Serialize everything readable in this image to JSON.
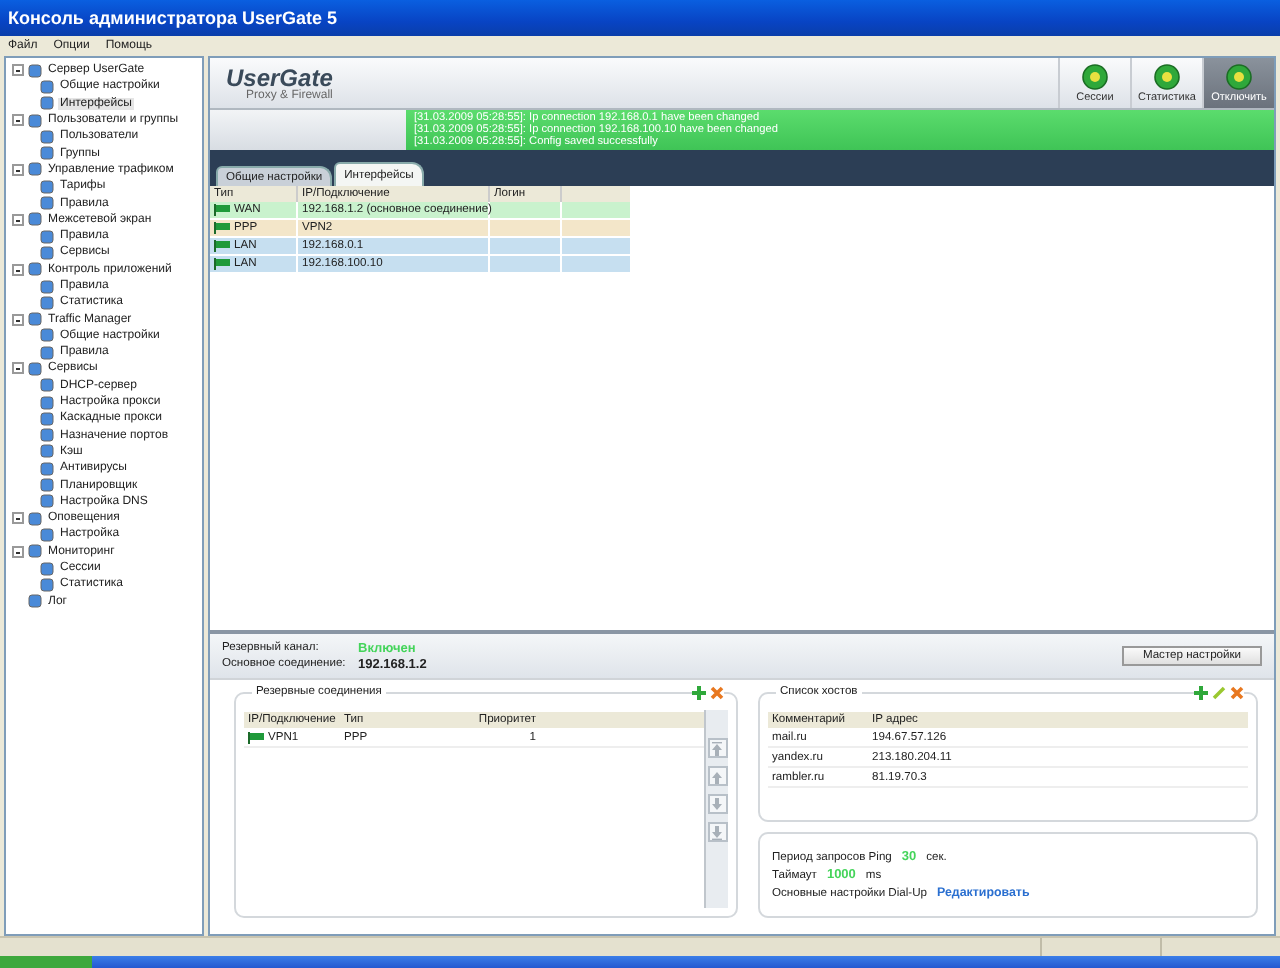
{
  "window": {
    "title": "Консоль администратора UserGate 5"
  },
  "menu": [
    "Файл",
    "Опции",
    "Помощь"
  ],
  "tree": [
    {
      "label": "Сервер UserGate",
      "expanded": true,
      "selected": false,
      "children": [
        {
          "label": "Общие настройки",
          "selected": false
        },
        {
          "label": "Интерфейсы",
          "selected": true
        }
      ]
    },
    {
      "label": "Пользователи и группы",
      "expanded": true,
      "selected": false,
      "children": [
        {
          "label": "Пользователи",
          "selected": false
        },
        {
          "label": "Группы",
          "selected": false
        }
      ]
    },
    {
      "label": "Управление трафиком",
      "expanded": true,
      "selected": false,
      "children": [
        {
          "label": "Тарифы",
          "selected": false
        },
        {
          "label": "Правила",
          "selected": false
        }
      ]
    },
    {
      "label": "Межсетевой экран",
      "expanded": true,
      "selected": false,
      "children": [
        {
          "label": "Правила",
          "selected": false
        },
        {
          "label": "Сервисы",
          "selected": false
        }
      ]
    },
    {
      "label": "Контроль приложений",
      "expanded": true,
      "selected": false,
      "children": [
        {
          "label": "Правила",
          "selected": false
        },
        {
          "label": "Статистика",
          "selected": false
        }
      ]
    },
    {
      "label": "Traffic Manager",
      "expanded": true,
      "selected": false,
      "children": [
        {
          "label": "Общие настройки",
          "selected": false
        },
        {
          "label": "Правила",
          "selected": false
        }
      ]
    },
    {
      "label": "Сервисы",
      "expanded": true,
      "selected": false,
      "children": [
        {
          "label": "DHCP-сервер",
          "selected": false
        },
        {
          "label": "Настройка прокси",
          "selected": false
        },
        {
          "label": "Каскадные прокси",
          "selected": false
        },
        {
          "label": "Назначение портов",
          "selected": false
        },
        {
          "label": "Кэш",
          "selected": false
        },
        {
          "label": "Антивирусы",
          "selected": false
        },
        {
          "label": "Планировщик",
          "selected": false
        },
        {
          "label": "Настройка DNS",
          "selected": false
        }
      ]
    },
    {
      "label": "Оповещения",
      "expanded": true,
      "selected": false,
      "children": [
        {
          "label": "Настройка",
          "selected": false
        }
      ]
    },
    {
      "label": "Мониторинг",
      "expanded": true,
      "selected": false,
      "children": [
        {
          "label": "Сессии",
          "selected": false
        },
        {
          "label": "Статистика",
          "selected": false
        }
      ]
    },
    {
      "label": "Лог",
      "selected": false
    }
  ],
  "logo": {
    "name": "UserGate",
    "tagline": "Proxy & Firewall"
  },
  "toolbar": [
    {
      "label": "Сессии",
      "selected": false
    },
    {
      "label": "Статистика",
      "selected": false
    },
    {
      "label": "Отключить",
      "selected": true
    }
  ],
  "log": [
    "[31.03.2009 05:28:55]: Ip connection 192.168.0.1 have been changed",
    "[31.03.2009 05:28:55]: Ip connection 192.168.100.10 have been changed",
    "[31.03.2009 05:28:55]: Config saved successfully"
  ],
  "tabs": [
    {
      "label": "Общие настройки",
      "selected": false
    },
    {
      "label": "Интерфейсы",
      "selected": true
    }
  ],
  "interfaces": {
    "columns": [
      "Тип",
      "IP/Подключение",
      "Логин"
    ],
    "rows": [
      {
        "type": "WAN",
        "address": "192.168.1.2 (основное соединение)",
        "color": "#c9f2cd"
      },
      {
        "type": "PPP",
        "address": "VPN2",
        "color": "#f3e6c9"
      },
      {
        "type": "LAN",
        "address": "192.168.0.1",
        "color": "#c6dff0"
      },
      {
        "type": "LAN",
        "address": "192.168.100.10",
        "color": "#c6dff0"
      }
    ]
  },
  "summary": {
    "backup_label": "Резервный канал:",
    "backup_value": "Включен",
    "main_label": "Основное соединение:",
    "main_value": "192.168.1.2",
    "wizard_button": "Мастер настройки"
  },
  "backup_connections": {
    "title": "Резервные соединения",
    "columns": [
      "IP/Подключение",
      "Тип",
      "Приоритет"
    ],
    "rows": [
      {
        "name": "VPN1",
        "type": "PPP",
        "priority": "1"
      }
    ]
  },
  "hosts": {
    "title": "Список хостов",
    "columns": [
      "Комментарий",
      "IP адрес"
    ],
    "rows": [
      {
        "comment": "mail.ru",
        "ip": "194.67.57.126"
      },
      {
        "comment": "yandex.ru",
        "ip": "213.180.204.11"
      },
      {
        "comment": "rambler.ru",
        "ip": "81.19.70.3"
      }
    ]
  },
  "ping": {
    "period_label": "Период запросов Ping",
    "period_value": "30",
    "period_unit": "сек.",
    "timeout_label": "Таймаут",
    "timeout_value": "1000",
    "timeout_unit": "ms",
    "dialup_label": "Основные настройки Dial-Up",
    "dialup_link": "Редактировать"
  }
}
